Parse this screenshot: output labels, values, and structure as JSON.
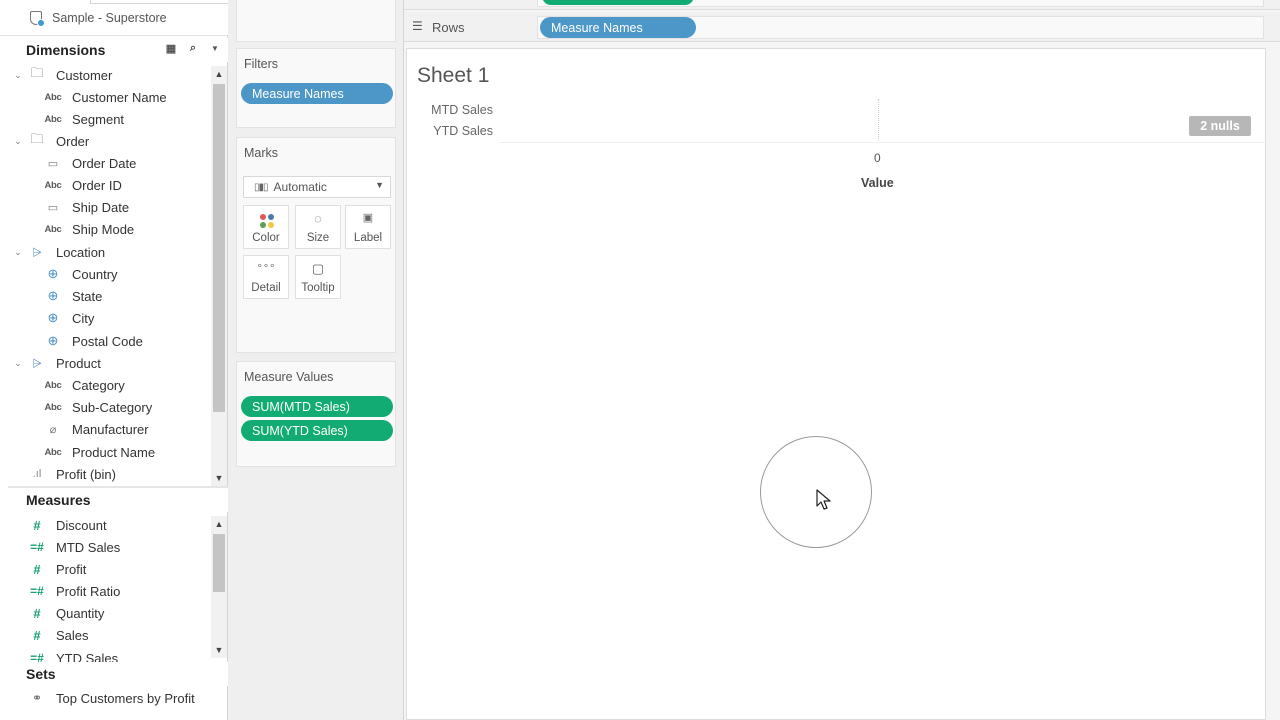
{
  "datasource": {
    "name": "Sample - Superstore"
  },
  "dimensions": {
    "title": "Dimensions",
    "items": [
      {
        "label": "Customer",
        "icon": "folder-icon",
        "type": "folder"
      },
      {
        "label": "Customer Name",
        "icon": "abc-icon",
        "type": "field"
      },
      {
        "label": "Segment",
        "icon": "abc-icon",
        "type": "field"
      },
      {
        "label": "Order",
        "icon": "folder-icon",
        "type": "folder"
      },
      {
        "label": "Order Date",
        "icon": "calendar-icon",
        "type": "field"
      },
      {
        "label": "Order ID",
        "icon": "abc-icon",
        "type": "field"
      },
      {
        "label": "Ship Date",
        "icon": "calendar-icon",
        "type": "field"
      },
      {
        "label": "Ship Mode",
        "icon": "abc-icon",
        "type": "field"
      },
      {
        "label": "Location",
        "icon": "hierarchy-icon",
        "type": "folder"
      },
      {
        "label": "Country",
        "icon": "globe-icon",
        "type": "field"
      },
      {
        "label": "State",
        "icon": "globe-icon",
        "type": "field"
      },
      {
        "label": "City",
        "icon": "globe-icon",
        "type": "field"
      },
      {
        "label": "Postal Code",
        "icon": "globe-icon",
        "type": "field"
      },
      {
        "label": "Product",
        "icon": "hierarchy-icon",
        "type": "folder"
      },
      {
        "label": "Category",
        "icon": "abc-icon",
        "type": "field"
      },
      {
        "label": "Sub-Category",
        "icon": "abc-icon",
        "type": "field"
      },
      {
        "label": "Manufacturer",
        "icon": "paperclip-icon",
        "type": "field"
      },
      {
        "label": "Product Name",
        "icon": "abc-icon",
        "type": "field"
      },
      {
        "label": "Profit (bin)",
        "icon": "bin-icon",
        "type": "top"
      }
    ]
  },
  "measures": {
    "title": "Measures",
    "items": [
      {
        "label": "Discount",
        "icon": "hash-icon"
      },
      {
        "label": "MTD Sales",
        "icon": "calc-hash-icon"
      },
      {
        "label": "Profit",
        "icon": "hash-icon"
      },
      {
        "label": "Profit Ratio",
        "icon": "calc-hash-icon"
      },
      {
        "label": "Quantity",
        "icon": "hash-icon"
      },
      {
        "label": "Sales",
        "icon": "hash-icon"
      },
      {
        "label": "YTD Sales",
        "icon": "calc-hash-icon"
      }
    ]
  },
  "sets": {
    "title": "Sets",
    "items": [
      {
        "label": "Top Customers by Profit",
        "icon": "set-icon"
      }
    ]
  },
  "filters": {
    "title": "Filters",
    "pills": [
      "Measure Names"
    ]
  },
  "marks": {
    "title": "Marks",
    "type": "Automatic",
    "buttons": [
      "Color",
      "Size",
      "Label",
      "Detail",
      "Tooltip"
    ]
  },
  "measure_values": {
    "title": "Measure Values",
    "pills": [
      "SUM(MTD Sales)",
      "SUM(YTD Sales)"
    ]
  },
  "shelves": {
    "rows_label": "Rows",
    "rows_pill": "Measure Names"
  },
  "view": {
    "sheet_title": "Sheet 1",
    "row_headers": [
      "MTD Sales",
      "YTD Sales"
    ],
    "axis_tick": "0",
    "axis_title": "Value",
    "nulls_badge": "2 nulls"
  },
  "colors": {
    "dimension_pill": "#4d97c8",
    "measure_pill": "#13ab74"
  }
}
